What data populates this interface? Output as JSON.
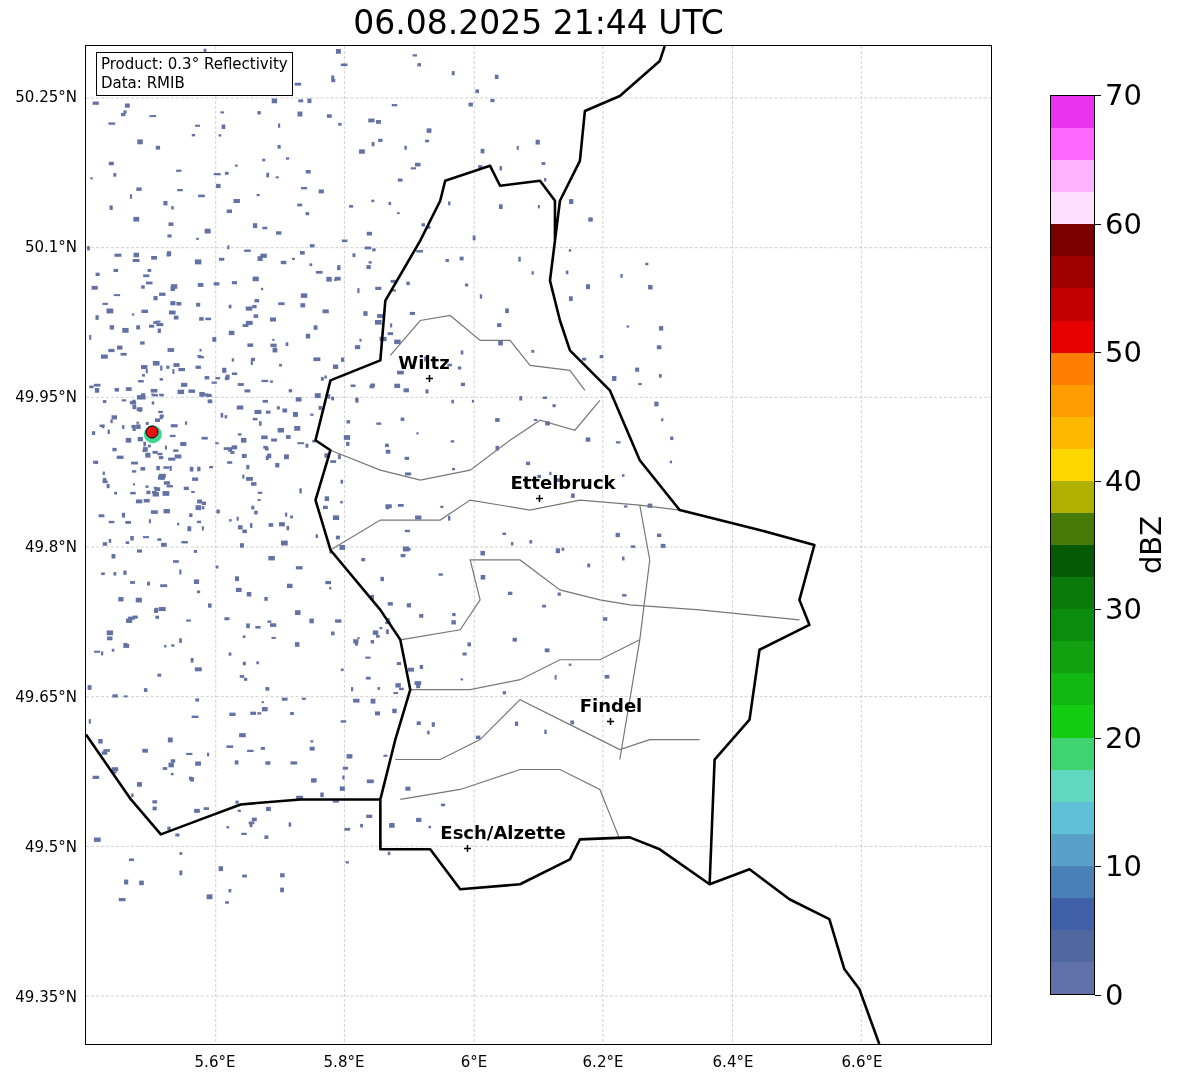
{
  "title": "06.08.2025 21:44 UTC",
  "info_box": {
    "lines": [
      "Product: 0.3° Reflectivity",
      "Data: RMIB"
    ]
  },
  "cities": [
    {
      "name": "Wiltz"
    },
    {
      "name": "Ettelbruck"
    },
    {
      "name": "Findel"
    },
    {
      "name": "Esch/Alzette"
    }
  ],
  "y_ticks": [
    "50.25°N",
    "50.1°N",
    "49.95°N",
    "49.8°N",
    "49.65°N",
    "49.5°N",
    "49.35°N"
  ],
  "x_ticks": [
    "5.6°E",
    "5.8°E",
    "6°E",
    "6.2°E",
    "6.4°E",
    "6.6°E"
  ],
  "colorbar": {
    "label": "dBZ",
    "ticks": [
      "70",
      "60",
      "50",
      "40",
      "30",
      "20",
      "10",
      "0"
    ],
    "bins": [
      {
        "color": "#e933ee"
      },
      {
        "color": "#ff66ff"
      },
      {
        "color": "#ffb3ff"
      },
      {
        "color": "#ffdfff"
      },
      {
        "color": "#7a0000"
      },
      {
        "color": "#9e0000"
      },
      {
        "color": "#c20000"
      },
      {
        "color": "#e60000"
      },
      {
        "color": "#ff8000"
      },
      {
        "color": "#ff9c00"
      },
      {
        "color": "#ffb800"
      },
      {
        "color": "#ffd700"
      },
      {
        "color": "#b0b000"
      },
      {
        "color": "#487a0a"
      },
      {
        "color": "#055a05"
      },
      {
        "color": "#0a7a0a"
      },
      {
        "color": "#0c8c0c"
      },
      {
        "color": "#10a010"
      },
      {
        "color": "#12b812"
      },
      {
        "color": "#12cc12"
      },
      {
        "color": "#40d470"
      },
      {
        "color": "#60d8c0"
      },
      {
        "color": "#60c0d8"
      },
      {
        "color": "#58a0c8"
      },
      {
        "color": "#4a80b8"
      },
      {
        "color": "#4060a8"
      },
      {
        "color": "#5068a0"
      },
      {
        "color": "#6070a8"
      }
    ]
  }
}
